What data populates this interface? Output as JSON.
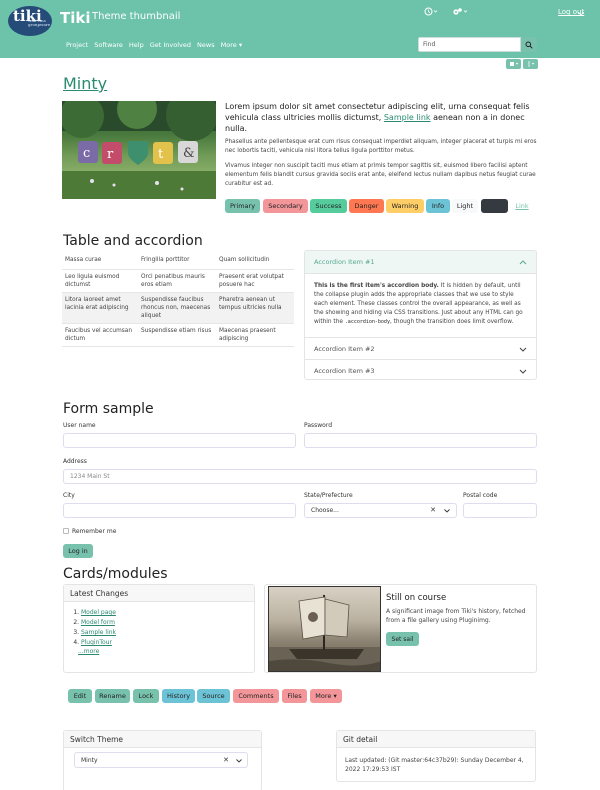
{
  "header": {
    "logo_text": "tiki",
    "logo_small": "wiki cms groupware",
    "site_title": "Tiki",
    "site_subtitle": "Theme thumbnail",
    "logout_label": "Log out",
    "nav": [
      "Project",
      "Software",
      "Help",
      "Get Involved",
      "News",
      "More"
    ],
    "search_placeholder": "Find"
  },
  "intro": {
    "title": "Minty",
    "lead_before_link": "Lorem ipsum dolor sit amet consectetur adipiscing elit, urna consequat felis vehicula class ultricies mollis dictumst, ",
    "lead_link": "Sample link",
    "lead_after_link": " aenean non a in donec nulla.",
    "para1": "Phasellus ante pellentesque erat cum risus consequat imperdiet aliquam, integer placerat et turpis mi eros nec lobortis taciti, vehicula nisl litora tellus ligula porttitor metus.",
    "para2": "Vivamus integer non suscipit taciti mus etiam at primis tempor sagittis sit, euismod libero facilisi aptent elementum felis blandit cursus gravida sociis erat ante, eleifend lectus nullam dapibus netus feugiat curae curabitur est ad.",
    "buttons": {
      "primary": "Primary",
      "secondary": "Secondary",
      "success": "Success",
      "danger": "Danger",
      "warning": "Warning",
      "info": "Info",
      "light": "Light",
      "dark": "Dark",
      "link": "Link"
    }
  },
  "table_section": {
    "title": "Table and accordion",
    "headers": [
      "Massa curae",
      "Fringilla porttitor",
      "Quam sollicitudin"
    ],
    "rows": [
      [
        "Leo ligula euismod dictumst",
        "Orci penatibus mauris eros etiam",
        "Praesent erat volutpat posuere hac"
      ],
      [
        "Litora laoreet amet lacinia erat adipiscing",
        "Suspendisse faucibus rhoncus non, maecenas aliquet",
        "Pharetra aenean ut tempus ultricies nulla"
      ],
      [
        "Faucibus vel accumsan dictum",
        "Suspendisse etiam risus",
        "Maecenas praesent adipiscing"
      ]
    ],
    "accordion": {
      "item1": "Accordion Item #1",
      "body_bold": "This is the first item's accordion body.",
      "body_text": " It is hidden by default, until the collapse plugin adds the appropriate classes that we use to style each element. These classes control the overall appearance, as well as the showing and hiding via CSS transitions. Just about any HTML can go within the ",
      "body_code": ".accordion-body",
      "body_end": ", though the transition does limit overflow.",
      "item2": "Accordion Item #2",
      "item3": "Accordion Item #3"
    }
  },
  "form": {
    "title": "Form sample",
    "user_label": "User name",
    "password_label": "Password",
    "address_label": "Address",
    "address_placeholder": "1234 Main St",
    "city_label": "City",
    "state_label": "State/Prefecture",
    "state_value": "Choose...",
    "postal_label": "Postal code",
    "remember_label": "Remember me",
    "login_label": "Log in"
  },
  "cards": {
    "title": "Cards/modules",
    "latest_changes_title": "Latest Changes",
    "changes": [
      "Model page",
      "Model form",
      "Sample link",
      "PluginTour"
    ],
    "more_label": "...more",
    "image_card_title": "Still on course",
    "image_card_text": "A significant image from Tiki's history, fetched from a file gallery using Pluginimg.",
    "set_sail_label": "Set sail"
  },
  "actions": [
    "Edit",
    "Rename",
    "Lock",
    "History",
    "Source",
    "Comments",
    "Files",
    "More"
  ],
  "switch_theme": {
    "title": "Switch Theme",
    "value": "Minty"
  },
  "git": {
    "title": "Git detail",
    "text": "Last updated: (Git master:64c37b29): Sunday December 4, 2022 17:29:53 IST"
  },
  "colors": {
    "primary": "#78c2ad",
    "secondary": "#f3969a",
    "success": "#56cc9d",
    "danger": "#ff7851",
    "warning": "#ffce67",
    "info": "#6cc3d5",
    "light": "#f8f9fa",
    "dark": "#343a40",
    "header": "#6cc3a9"
  }
}
